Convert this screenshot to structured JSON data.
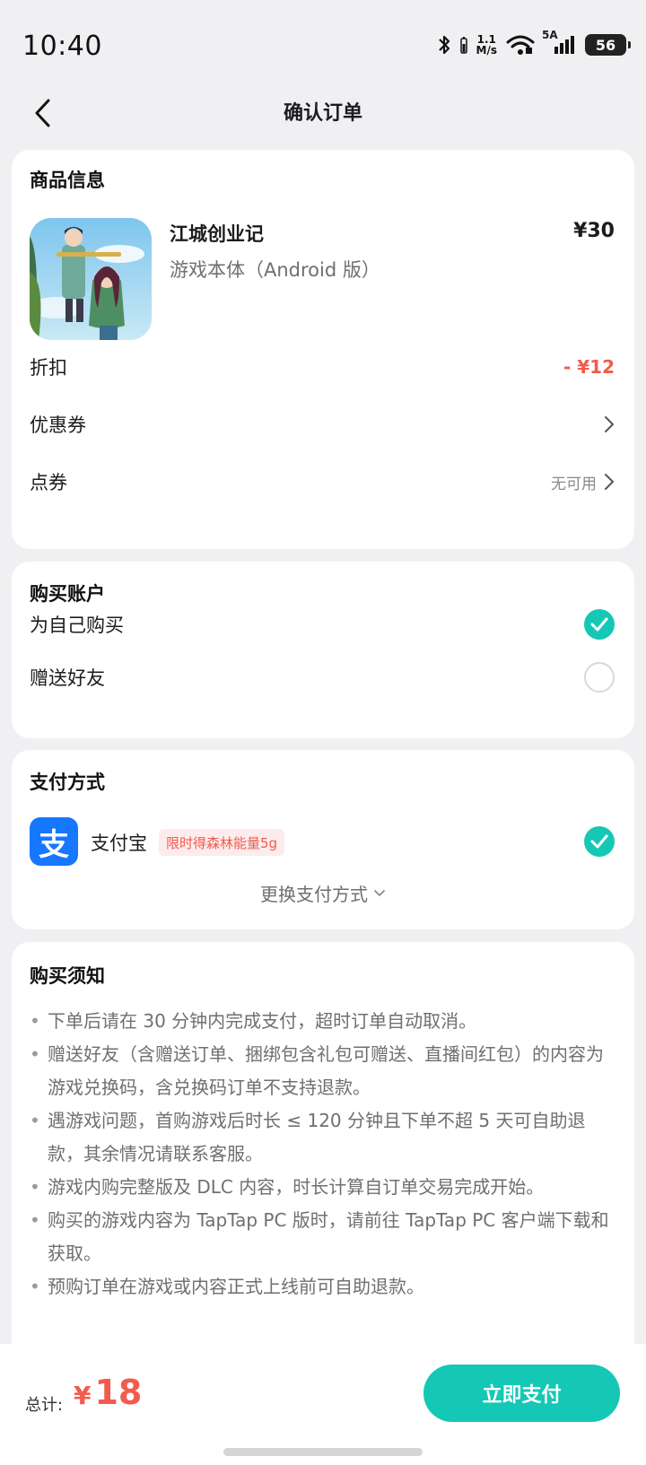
{
  "status_bar": {
    "time": "10:40",
    "speed_value": "1.1",
    "speed_unit": "M/s",
    "network": "5A",
    "battery": "56",
    "icons": [
      "bluetooth-icon",
      "wifi-icon",
      "signal-icon",
      "battery-icon"
    ]
  },
  "nav": {
    "title": "确认订单",
    "back_icon": "chevron-left-icon"
  },
  "product": {
    "section_title": "商品信息",
    "name": "江城创业记",
    "sub": "游戏本体（Android 版）",
    "price": "¥30",
    "rows": {
      "discount_label": "折扣",
      "discount_value": "- ¥12",
      "coupon_label": "优惠券",
      "points_label": "点券",
      "points_value": "无可用"
    }
  },
  "account": {
    "section_title": "购买账户",
    "options": [
      {
        "label": "为自己购买",
        "selected": true
      },
      {
        "label": "赠送好友",
        "selected": false
      }
    ]
  },
  "payment": {
    "section_title": "支付方式",
    "method_logo": "支",
    "method_name": "支付宝",
    "promo": "限时得森林能量5g",
    "change_label": "更换支付方式"
  },
  "notice": {
    "section_title": "购买须知",
    "items": [
      "下单后请在 30 分钟内完成支付，超时订单自动取消。",
      "赠送好友（含赠送订单、捆绑包含礼包可赠送、直播间红包）的内容为游戏兑换码，含兑换码订单不支持退款。",
      "遇游戏问题，首购游戏后时长 ≤ 120 分钟且下单不超 5 天可自助退款，其余情况请联系客服。",
      "游戏内购完整版及 DLC 内容，时长计算自订单交易完成开始。",
      "购买的游戏内容为 TapTap PC 版时，请前往 TapTap PC 客户端下载和获取。",
      "预购订单在游戏或内容正式上线前可自助退款。"
    ]
  },
  "bottom": {
    "total_label": "总计:",
    "currency": "¥",
    "total_value": "18",
    "pay_button": "立即支付"
  },
  "colors": {
    "accent": "#15c8b5",
    "price_red": "#f25b4d",
    "alipay_blue": "#1677ff",
    "background": "#f0f0f3"
  }
}
